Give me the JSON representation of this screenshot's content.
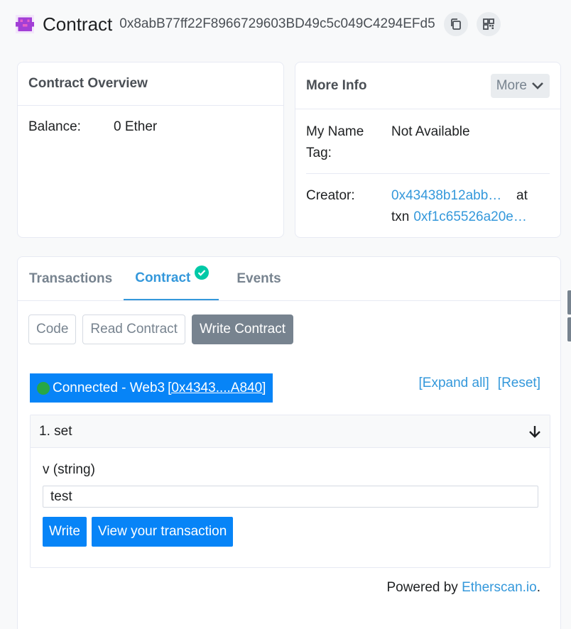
{
  "header": {
    "title": "Contract",
    "address": "0x8abB77ff22F8966729603BD49c5c049C4294EFd5"
  },
  "overview": {
    "title": "Contract Overview",
    "balance_label": "Balance:",
    "balance_value": "0 Ether"
  },
  "more_info": {
    "title": "More Info",
    "more_button": "More",
    "name_tag_label_1": "My Name",
    "name_tag_label_2": "Tag:",
    "name_tag_value": "Not Available",
    "creator_label": "Creator:",
    "creator_address": "0x43438b12abb…",
    "at_text": "at",
    "txn_text": "txn",
    "txn_hash": "0xf1c65526a20e…"
  },
  "tabs": {
    "transactions": "Transactions",
    "contract": "Contract",
    "events": "Events"
  },
  "contract_buttons": {
    "code": "Code",
    "read": "Read Contract",
    "write": "Write Contract"
  },
  "connection": {
    "label": "Connected - Web3 ",
    "account": "[0x4343....A840]"
  },
  "links": {
    "expand_all": "[Expand all]",
    "reset": "[Reset]"
  },
  "function": {
    "title": "1. set",
    "param_label": "v (string)",
    "param_value": "test",
    "write_button": "Write",
    "view_tx_button": "View your transaction"
  },
  "footer": {
    "powered_by": "Powered by ",
    "etherscan": "Etherscan.io",
    "period": "."
  },
  "colors": {
    "accent": "#3498db",
    "primary": "#0784f7",
    "success": "#00c9a7",
    "muted": "#77838f"
  }
}
